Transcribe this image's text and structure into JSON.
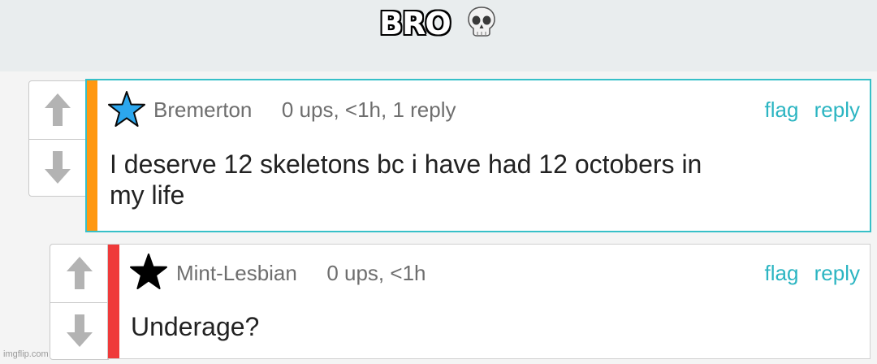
{
  "caption": {
    "text": "BRO",
    "emoji": "skull-emoji"
  },
  "colors": {
    "accent": "#2cb5c2",
    "stripe_op": "#ff9810",
    "stripe_reply": "#ef3a3a",
    "star_op": "#2ca7ee",
    "star_reply": "#000000"
  },
  "comments": [
    {
      "username": "Bremerton",
      "meta": "0 ups, <1h, 1 reply",
      "flag_label": "flag",
      "reply_label": "reply",
      "body_line1": "I deserve 12 skeletons bc i have had 12 octobers in",
      "body_line2": "my life"
    },
    {
      "username": "Mint-Lesbian",
      "meta": "0 ups, <1h",
      "flag_label": "flag",
      "reply_label": "reply",
      "body_line1": "Underage?"
    }
  ],
  "watermark": "imgflip.com"
}
